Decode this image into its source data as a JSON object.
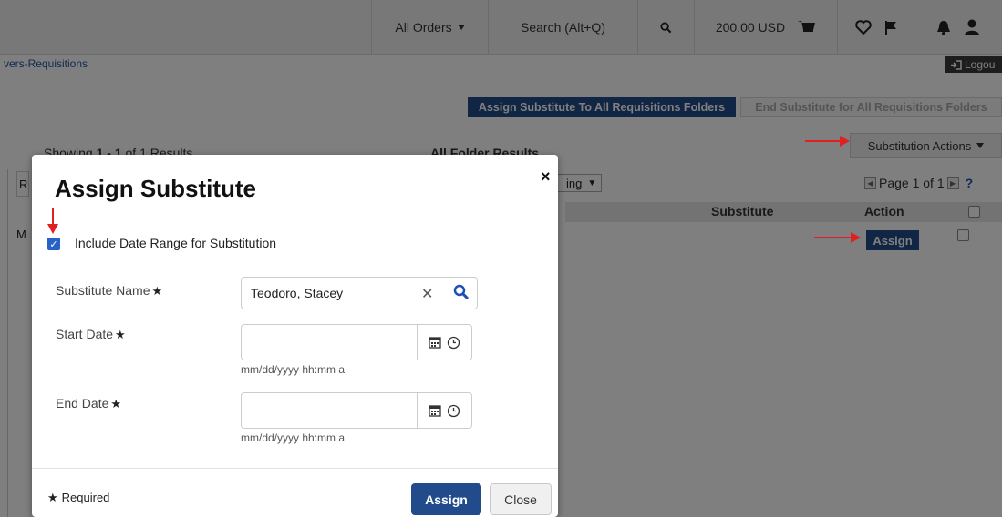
{
  "header": {
    "orders_menu": "All Orders",
    "search_placeholder": "Search (Alt+Q)",
    "cart_total": "200.00 USD"
  },
  "subbar": {
    "breadcrumb": "vers-Requisitions",
    "logout": "Logou"
  },
  "page": {
    "assign_all_button": "Assign Substitute To All Requisitions Folders",
    "end_all_button": "End Substitute for All Requisitions Folders",
    "showing_prefix": "Showing ",
    "showing_range": "1 - 1",
    "showing_suffix": " of 1 Results",
    "folder_results": "All Folder Results",
    "substitution_actions": "Substitution Actions",
    "sort_select_partial": "ing",
    "pager_text": "Page 1 of 1",
    "pager_help": "?",
    "col_substitute": "Substitute",
    "col_action": "Action",
    "row_assign_button": "Assign",
    "left_frag_top": "R",
    "left_frag_row": "M"
  },
  "modal": {
    "title": "Assign Substitute",
    "close": "×",
    "date_range_label": "Include Date Range for Substitution",
    "date_range_checked": true,
    "substitute_name_label": "Substitute Name",
    "substitute_name_value": "Teodoro, Stacey",
    "start_date_label": "Start Date",
    "end_date_label": "End Date",
    "date_hint": "mm/dd/yyyy hh:mm a",
    "required_note": "Required",
    "assign_button": "Assign",
    "close_button": "Close"
  },
  "colors": {
    "primary": "#224b8b",
    "checkbox": "#2563c9",
    "arrow": "#e02020"
  },
  "icons": [
    "caret-down-icon",
    "search-icon",
    "cart-icon",
    "heart-icon",
    "flag-icon",
    "bell-icon",
    "user-icon",
    "logout-icon",
    "calendar-icon",
    "clock-icon",
    "clear-icon",
    "star-icon"
  ]
}
